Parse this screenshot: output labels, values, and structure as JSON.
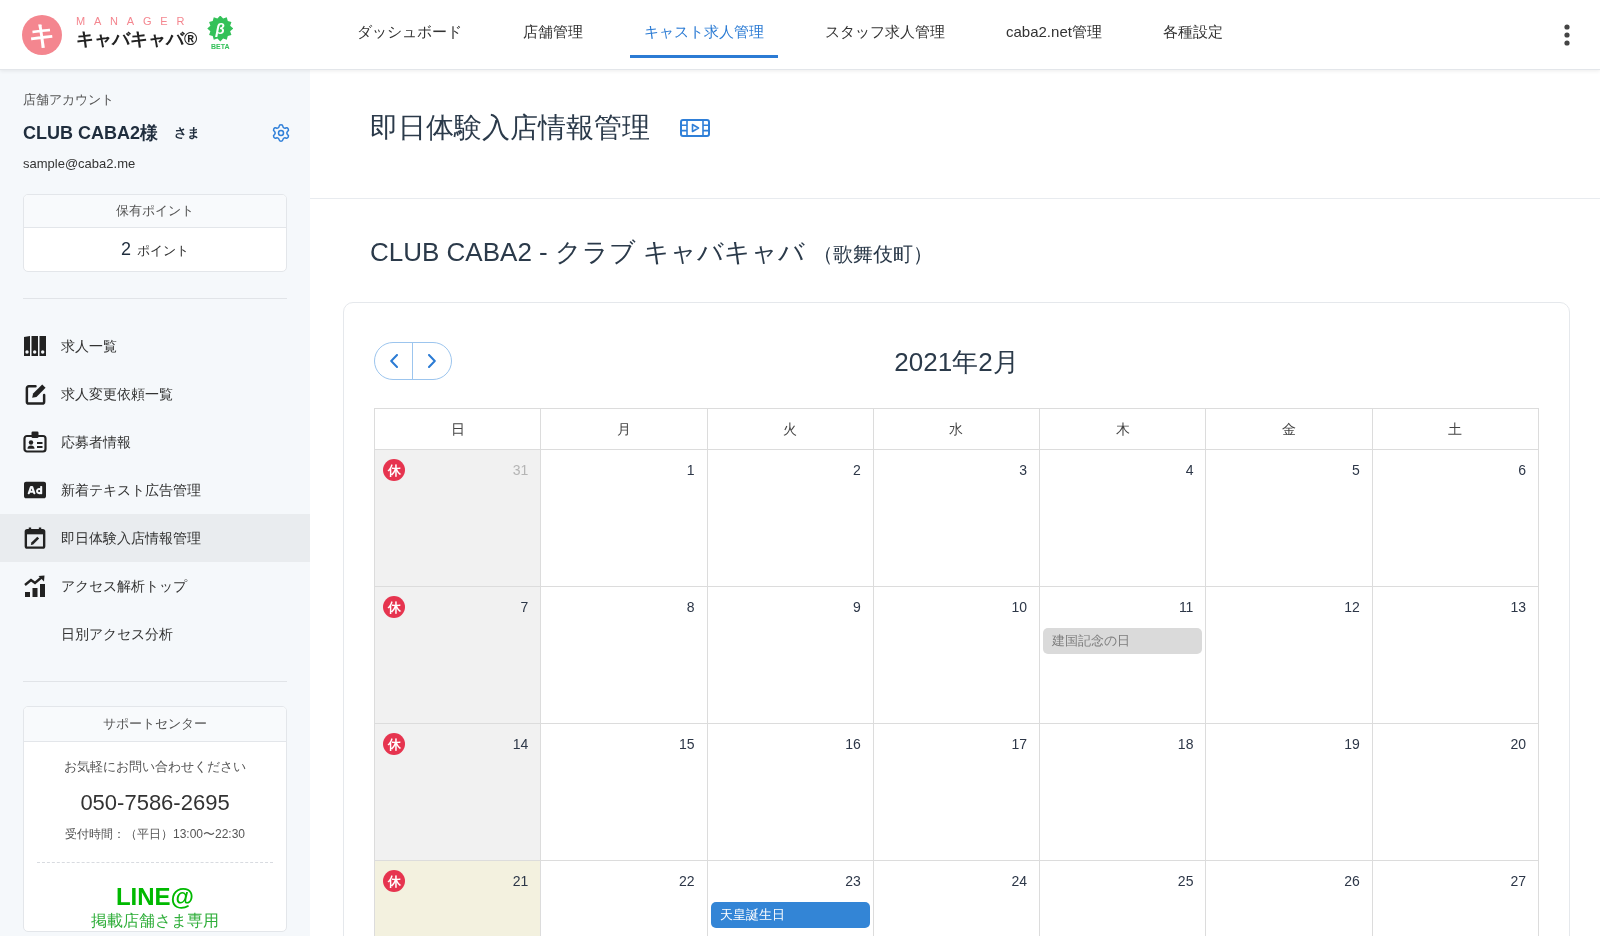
{
  "header": {
    "logo": {
      "mark": "キ",
      "tagline": "MANAGER",
      "name": "キャバキャバ®",
      "beta_mark": "β",
      "beta_label": "BETA"
    },
    "nav": [
      {
        "label": "ダッシュボード",
        "selected": false
      },
      {
        "label": "店舗管理",
        "selected": false
      },
      {
        "label": "キャスト求人管理",
        "selected": true
      },
      {
        "label": "スタッフ求人管理",
        "selected": false
      },
      {
        "label": "caba2.net管理",
        "selected": false
      },
      {
        "label": "各種設定",
        "selected": false
      }
    ]
  },
  "sidebar": {
    "account_label": "店舗アカウント",
    "account_name": "CLUB CABA2様",
    "honorific": "さま",
    "email": "sample@caba2.me",
    "points": {
      "title": "保有ポイント",
      "value": "2",
      "unit": "ポイント"
    },
    "menu": [
      {
        "label": "求人一覧",
        "selected": false
      },
      {
        "label": "求人変更依頼一覧",
        "selected": false
      },
      {
        "label": "応募者情報",
        "selected": false
      },
      {
        "label": "新着テキスト広告管理",
        "selected": false
      },
      {
        "label": "即日体験入店情報管理",
        "selected": true
      },
      {
        "label": "アクセス解析トップ",
        "selected": false,
        "children": [
          {
            "label": "日別アクセス分析",
            "selected": false
          }
        ]
      }
    ],
    "support": {
      "title": "サポートセンター",
      "message": "お気軽にお問い合わせください",
      "phone": "050-7586-2695",
      "hours": "受付時間：（平日）13:00〜22:30",
      "line": "LINE@",
      "line_note": "掲載店舗さま専用"
    }
  },
  "page": {
    "title": "即日体験入店情報管理",
    "subtitle": "CLUB CABA2 - クラブ キャバキャバ",
    "area": "（歌舞伎町）"
  },
  "calendar": {
    "month": "2021年2月",
    "weekdays": [
      "日",
      "月",
      "火",
      "水",
      "木",
      "金",
      "土"
    ],
    "weeks": [
      [
        {
          "day": "31",
          "outside": true,
          "closed": true,
          "today": false,
          "badge": "休"
        },
        {
          "day": "1",
          "outside": false,
          "closed": false,
          "today": false
        },
        {
          "day": "2",
          "outside": false,
          "closed": false,
          "today": false
        },
        {
          "day": "3",
          "outside": false,
          "closed": false,
          "today": false
        },
        {
          "day": "4",
          "outside": false,
          "closed": false,
          "today": false
        },
        {
          "day": "5",
          "outside": false,
          "closed": false,
          "today": false
        },
        {
          "day": "6",
          "outside": false,
          "closed": false,
          "today": false
        }
      ],
      [
        {
          "day": "7",
          "outside": false,
          "closed": true,
          "today": false,
          "badge": "休"
        },
        {
          "day": "8",
          "outside": false,
          "closed": false,
          "today": false
        },
        {
          "day": "9",
          "outside": false,
          "closed": false,
          "today": false
        },
        {
          "day": "10",
          "outside": false,
          "closed": false,
          "today": false
        },
        {
          "day": "11",
          "outside": false,
          "closed": false,
          "today": false,
          "events": [
            {
              "label": "建国記念の日",
              "disabled": true
            }
          ]
        },
        {
          "day": "12",
          "outside": false,
          "closed": false,
          "today": false
        },
        {
          "day": "13",
          "outside": false,
          "closed": false,
          "today": false
        }
      ],
      [
        {
          "day": "14",
          "outside": false,
          "closed": true,
          "today": false,
          "badge": "休"
        },
        {
          "day": "15",
          "outside": false,
          "closed": false,
          "today": false
        },
        {
          "day": "16",
          "outside": false,
          "closed": false,
          "today": false
        },
        {
          "day": "17",
          "outside": false,
          "closed": false,
          "today": false
        },
        {
          "day": "18",
          "outside": false,
          "closed": false,
          "today": false
        },
        {
          "day": "19",
          "outside": false,
          "closed": false,
          "today": false
        },
        {
          "day": "20",
          "outside": false,
          "closed": false,
          "today": false
        }
      ],
      [
        {
          "day": "21",
          "outside": false,
          "closed": true,
          "today": true,
          "badge": "休"
        },
        {
          "day": "22",
          "outside": false,
          "closed": false,
          "today": false
        },
        {
          "day": "23",
          "outside": false,
          "closed": false,
          "today": false,
          "events": [
            {
              "label": "天皇誕生日",
              "disabled": false
            }
          ]
        },
        {
          "day": "24",
          "outside": false,
          "closed": false,
          "today": false
        },
        {
          "day": "25",
          "outside": false,
          "closed": false,
          "today": false
        },
        {
          "day": "26",
          "outside": false,
          "closed": false,
          "today": false
        },
        {
          "day": "27",
          "outside": false,
          "closed": false,
          "today": false
        }
      ]
    ]
  }
}
